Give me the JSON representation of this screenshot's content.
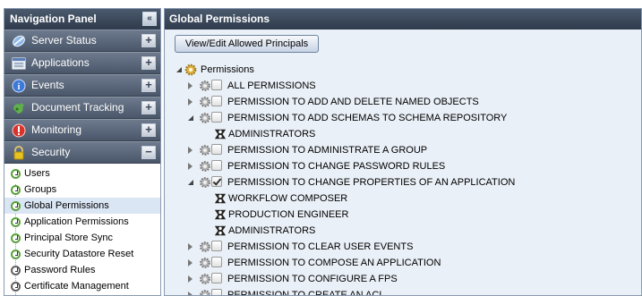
{
  "nav": {
    "title": "Navigation Panel",
    "sections": [
      {
        "label": "Server Status",
        "icon": "server-status-icon"
      },
      {
        "label": "Applications",
        "icon": "applications-icon"
      },
      {
        "label": "Events",
        "icon": "events-icon"
      },
      {
        "label": "Document Tracking",
        "icon": "document-tracking-icon"
      },
      {
        "label": "Monitoring",
        "icon": "monitoring-icon"
      },
      {
        "label": "Security",
        "icon": "lock-icon"
      }
    ],
    "security_items": [
      "Users",
      "Groups",
      "Global Permissions",
      "Application Permissions",
      "Principal Store Sync",
      "Security Datastore Reset",
      "Password Rules",
      "Certificate Management"
    ]
  },
  "main": {
    "title": "Global Permissions",
    "view_button": "View/Edit Allowed Principals",
    "tree": {
      "root": "Permissions",
      "items": [
        {
          "label": "ALL PERMISSIONS",
          "checked": false,
          "expanded": false
        },
        {
          "label": "PERMISSION TO ADD AND DELETE NAMED OBJECTS",
          "checked": false,
          "expanded": false
        },
        {
          "label": "PERMISSION TO ADD SCHEMAS TO SCHEMA REPOSITORY",
          "checked": false,
          "expanded": true,
          "principals": [
            "ADMINISTRATORS"
          ]
        },
        {
          "label": "PERMISSION TO ADMINISTRATE A GROUP",
          "checked": false,
          "expanded": false
        },
        {
          "label": "PERMISSION TO CHANGE PASSWORD RULES",
          "checked": false,
          "expanded": false
        },
        {
          "label": "PERMISSION TO CHANGE PROPERTIES OF AN APPLICATION",
          "checked": true,
          "expanded": true,
          "principals": [
            "WORKFLOW COMPOSER",
            "PRODUCTION ENGINEER",
            "ADMINISTRATORS"
          ]
        },
        {
          "label": "PERMISSION TO CLEAR USER EVENTS",
          "checked": false,
          "expanded": false
        },
        {
          "label": "PERMISSION TO COMPOSE AN APPLICATION",
          "checked": false,
          "expanded": false
        },
        {
          "label": "PERMISSION TO CONFIGURE A FPS",
          "checked": false,
          "expanded": false
        },
        {
          "label": "PERMISSION TO CREATE AN ACL",
          "checked": false,
          "expanded": false
        }
      ]
    }
  },
  "colors": {
    "header_bg": "#3b4759",
    "section_bg": "#5b677a",
    "body_bg": "#eaf0f7",
    "active_item": "#dbe6f5",
    "bullet_green": "#59a03a"
  }
}
